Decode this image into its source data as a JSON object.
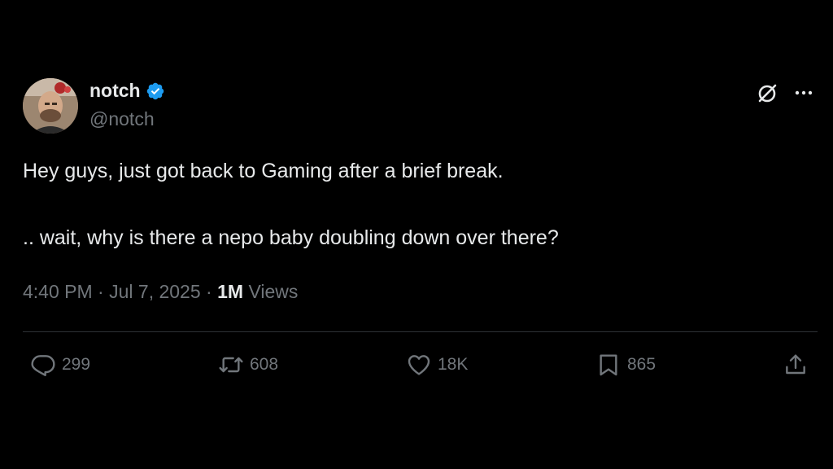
{
  "author": {
    "display_name": "notch",
    "handle": "@notch",
    "verified": true,
    "verified_color": "#1d9bf0"
  },
  "tweet": {
    "lines": [
      "Hey guys, just got back to Gaming after a brief break.",
      ".. wait, why is there a nepo baby doubling down over there?"
    ],
    "time": "4:40 PM",
    "date": "Jul 7, 2025",
    "views_count": "1M",
    "views_label": "Views",
    "separator": "·"
  },
  "actions": {
    "replies": "299",
    "reposts": "608",
    "likes": "18K",
    "bookmarks": "865"
  },
  "icons": {
    "reply": "reply-icon",
    "repost": "repost-icon",
    "like": "heart-icon",
    "bookmark": "bookmark-icon",
    "share": "share-icon",
    "grok": "grok-icon",
    "more": "more-icon"
  },
  "colors": {
    "background": "#000000",
    "text": "#e7e9ea",
    "secondary": "#71767b",
    "divider": "#2f3336"
  }
}
